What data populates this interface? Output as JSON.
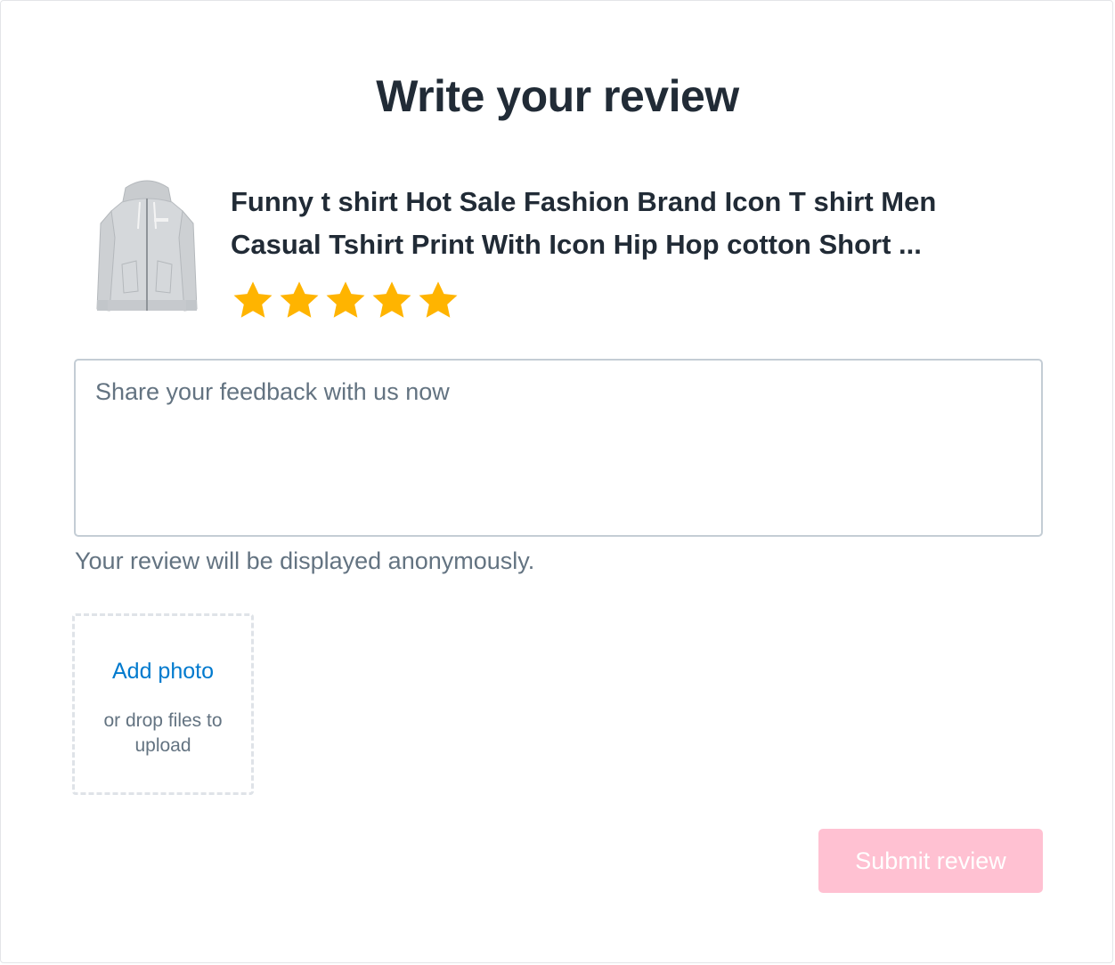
{
  "page": {
    "title": "Write your review"
  },
  "product": {
    "name_line1": "Funny t shirt Hot Sale Fashion Brand Icon T shirt Men",
    "name_line2": "Casual Tshirt Print With Icon Hip Hop cotton Short ...",
    "thumbnail_icon": "grey-zip-hoodie-image",
    "rating": 5,
    "rating_max": 5,
    "star_color": "#ffb400"
  },
  "form": {
    "feedback_placeholder": "Share your feedback with us now",
    "feedback_value": "",
    "anonymity_note": "Your review will be displayed anonymously.",
    "upload": {
      "add_label": "Add photo",
      "drop_hint": "or drop files to upload"
    },
    "submit_label": "Submit review",
    "submit_color": "#ffc1d2",
    "link_color": "#007ace"
  }
}
